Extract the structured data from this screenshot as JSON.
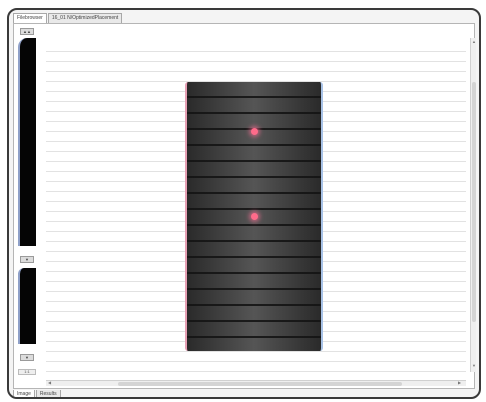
{
  "window": {
    "tabs": [
      {
        "label": "Filebrowser",
        "active": true
      },
      {
        "label": "16_01 N/OptimizedPlacement",
        "active": false
      }
    ]
  },
  "side": {
    "top_button": "▲▲",
    "mid_button": "▼",
    "bottom_button": "▼",
    "zoom_value": "1:1"
  },
  "canvas": {
    "markers": [
      {
        "name": "marker-1",
        "color": "#ff6b8a"
      },
      {
        "name": "marker-2",
        "color": "#ff6b8a"
      }
    ]
  },
  "bottom_tabs": [
    {
      "label": "Image",
      "active": true
    },
    {
      "label": "Results",
      "active": false
    }
  ]
}
